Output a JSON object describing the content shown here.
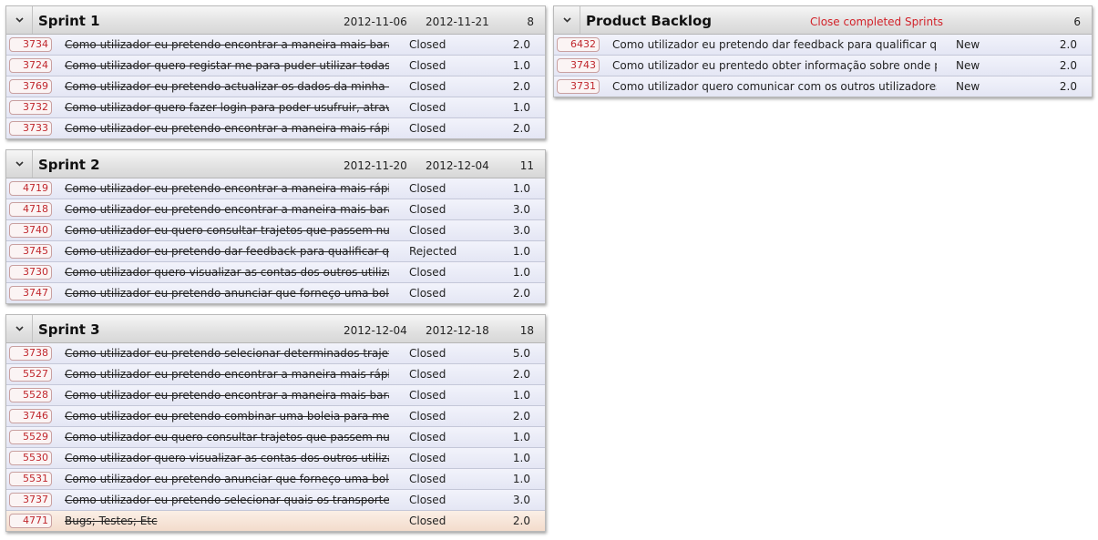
{
  "sprints": [
    {
      "title": "Sprint 1",
      "start": "2012-11-06",
      "end": "2012-11-21",
      "count": "8",
      "items": [
        {
          "id": "3734",
          "text": "Como utilizador eu pretendo encontrar a maneira mais barata",
          "status": "Closed",
          "points": "2.0"
        },
        {
          "id": "3724",
          "text": "Como utilizador quero registar-me para puder utilizar todas a",
          "status": "Closed",
          "points": "1.0"
        },
        {
          "id": "3769",
          "text": "Como utilizador eu pretendo actualizar os dados da minha cor",
          "status": "Closed",
          "points": "2.0"
        },
        {
          "id": "3732",
          "text": "Como utilizador quero fazer login para poder usufruir, através",
          "status": "Closed",
          "points": "1.0"
        },
        {
          "id": "3733",
          "text": "Como utilizador eu pretendo encontrar a maneira mais rápida",
          "status": "Closed",
          "points": "2.0"
        }
      ]
    },
    {
      "title": "Sprint 2",
      "start": "2012-11-20",
      "end": "2012-12-04",
      "count": "11",
      "items": [
        {
          "id": "4719",
          "text": "Como utilizador eu pretendo encontrar a maneira mais rápida",
          "status": "Closed",
          "points": "1.0"
        },
        {
          "id": "4718",
          "text": "Como utilizador eu pretendo encontrar a maneira mais barata",
          "status": "Closed",
          "points": "3.0"
        },
        {
          "id": "3740",
          "text": "Como utilizador eu quero consultar trajetos que passem num",
          "status": "Closed",
          "points": "3.0"
        },
        {
          "id": "3745",
          "text": " Como utilizador eu pretendo dar feedback para qualificar que",
          "status": "Rejected",
          "points": "1.0"
        },
        {
          "id": "3730",
          "text": "Como utilizador quero visualizar as contas dos outros utilizado",
          "status": "Closed",
          "points": "1.0"
        },
        {
          "id": "3747",
          "text": "Como utilizador eu pretendo anunciar que forneço uma boleia",
          "status": "Closed",
          "points": "2.0"
        }
      ]
    },
    {
      "title": "Sprint 3",
      "start": "2012-12-04",
      "end": "2012-12-18",
      "count": "18",
      "items": [
        {
          "id": "3738",
          "text": "Como utilizador eu pretendo selecionar determinados trajetos",
          "status": "Closed",
          "points": "5.0"
        },
        {
          "id": "5527",
          "text": "Como utilizador eu pretendo encontrar a maneira mais rápida",
          "status": "Closed",
          "points": "2.0"
        },
        {
          "id": "5528",
          "text": "Como utilizador eu pretendo encontrar a maneira mais barata",
          "status": "Closed",
          "points": "1.0"
        },
        {
          "id": "3746",
          "text": "Como utilizador eu pretendo combinar uma boleia para me pu",
          "status": "Closed",
          "points": "2.0"
        },
        {
          "id": "5529",
          "text": "Como utilizador eu quero consultar trajetos que passem num",
          "status": "Closed",
          "points": "1.0"
        },
        {
          "id": "5530",
          "text": "Como utilizador quero visualizar as contas dos outros utilizado",
          "status": "Closed",
          "points": "1.0"
        },
        {
          "id": "5531",
          "text": "Como utilizador eu pretendo anunciar que forneço uma boleia",
          "status": "Closed",
          "points": "1.0"
        },
        {
          "id": "3737",
          "text": "Como utilizador eu pretendo selecionar quais os transportes a",
          "status": "Closed",
          "points": "3.0"
        },
        {
          "id": "4771",
          "text": "Bugs; Testes; Etc",
          "status": "Closed",
          "points": "2.0"
        }
      ]
    }
  ],
  "backlog": {
    "title": "Product Backlog",
    "close_link": "Close completed Sprints",
    "count": "6",
    "items": [
      {
        "id": "6432",
        "text": " Como utilizador eu pretendo dar feedback para qualificar que",
        "status": "New",
        "points": "2.0"
      },
      {
        "id": "3743",
        "text": "Como utilizador eu prentedo obter informação sobre onde pos",
        "status": "New",
        "points": "2.0"
      },
      {
        "id": "3731",
        "text": "Como utilizador quero comunicar com os outros utilizadores p",
        "status": "New",
        "points": "2.0"
      }
    ]
  },
  "colors": {
    "id_text": "#c0272d",
    "link": "#d2232a",
    "row_bg": "#e8eaf6",
    "bug_row_bg": "#f6e3d6"
  },
  "icons": {
    "toggle": "chevron-down-icon"
  }
}
